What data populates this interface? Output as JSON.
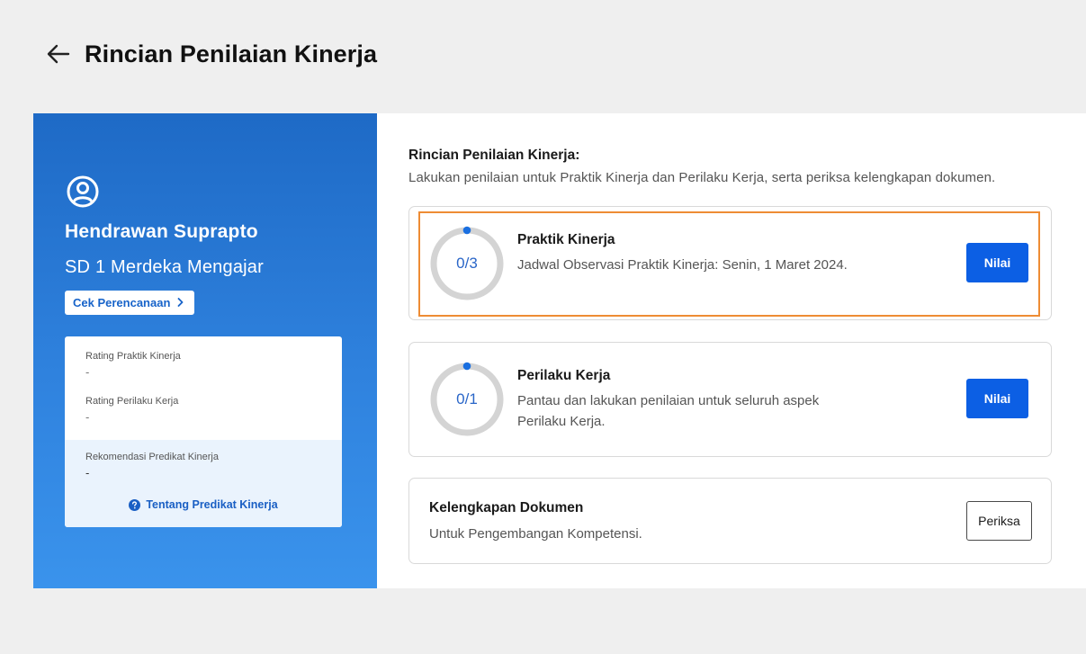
{
  "header": {
    "title": "Rincian Penilaian Kinerja"
  },
  "profile": {
    "name": "Hendrawan Suprapto",
    "school": "SD 1 Merdeka Mengajar",
    "plan_button_label": "Cek Perencanaan",
    "ratings": [
      {
        "label": "Rating Praktik Kinerja",
        "value": "-"
      },
      {
        "label": "Rating Perilaku Kerja",
        "value": "-"
      }
    ],
    "recommendation": {
      "label": "Rekomendasi Predikat Kinerja",
      "value": "-"
    },
    "about_link_label": "Tentang Predikat Kinerja"
  },
  "detail": {
    "title": "Rincian Penilaian Kinerja:",
    "subtitle": "Lakukan penilaian untuk Praktik Kinerja dan Perilaku Kerja, serta periksa kelengkapan dokumen.",
    "tasks": [
      {
        "progress_label": "0/3",
        "done": 0,
        "total": 3,
        "title": "Praktik Kinerja",
        "description": "Jadwal Observasi Praktik Kinerja: Senin, 1 Maret 2024.",
        "button_label": "Nilai"
      },
      {
        "progress_label": "0/1",
        "done": 0,
        "total": 1,
        "title": "Perilaku Kerja",
        "description": "Pantau dan lakukan penilaian untuk seluruh aspek Perilaku Kerja.",
        "button_label": "Nilai"
      }
    ],
    "documents": {
      "title": "Kelengkapan Dokumen",
      "description": "Untuk Pengembangan Kompetensi.",
      "button_label": "Periksa"
    }
  },
  "colors": {
    "accent": "#0c5fe4",
    "panel_blue": "#2f82de",
    "highlight": "#ee8c34",
    "ring_track": "#d4d4d4",
    "ring_dot": "#1a6fe0"
  }
}
